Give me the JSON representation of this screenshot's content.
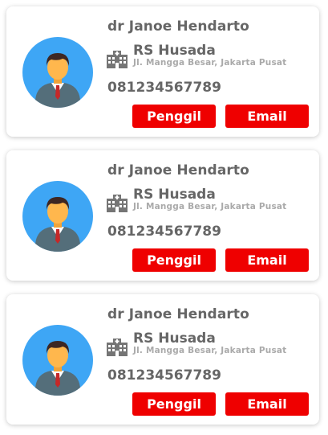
{
  "doctors": [
    {
      "name": "dr Janoe Hendarto",
      "hospital": "RS Husada",
      "address": "Jl. Mangga Besar, Jakarta Pusat",
      "phone": "081234567789",
      "call_label": "Penggil",
      "email_label": "Email"
    },
    {
      "name": "dr Janoe Hendarto",
      "hospital": "RS Husada",
      "address": "Jl. Mangga Besar, Jakarta Pusat",
      "phone": "081234567789",
      "call_label": "Penggil",
      "email_label": "Email"
    },
    {
      "name": "dr Janoe Hendarto",
      "hospital": "RS Husada",
      "address": "Jl. Mangga Besar, Jakarta Pusat",
      "phone": "081234567789",
      "call_label": "Penggil",
      "email_label": "Email"
    }
  ],
  "colors": {
    "button": "#ef0000",
    "avatar_bg": "#3ea6f5",
    "text": "#666666",
    "muted": "#aaaaaa"
  },
  "icons": {
    "avatar": "doctor-avatar-icon",
    "hospital": "hospital-building-icon"
  }
}
